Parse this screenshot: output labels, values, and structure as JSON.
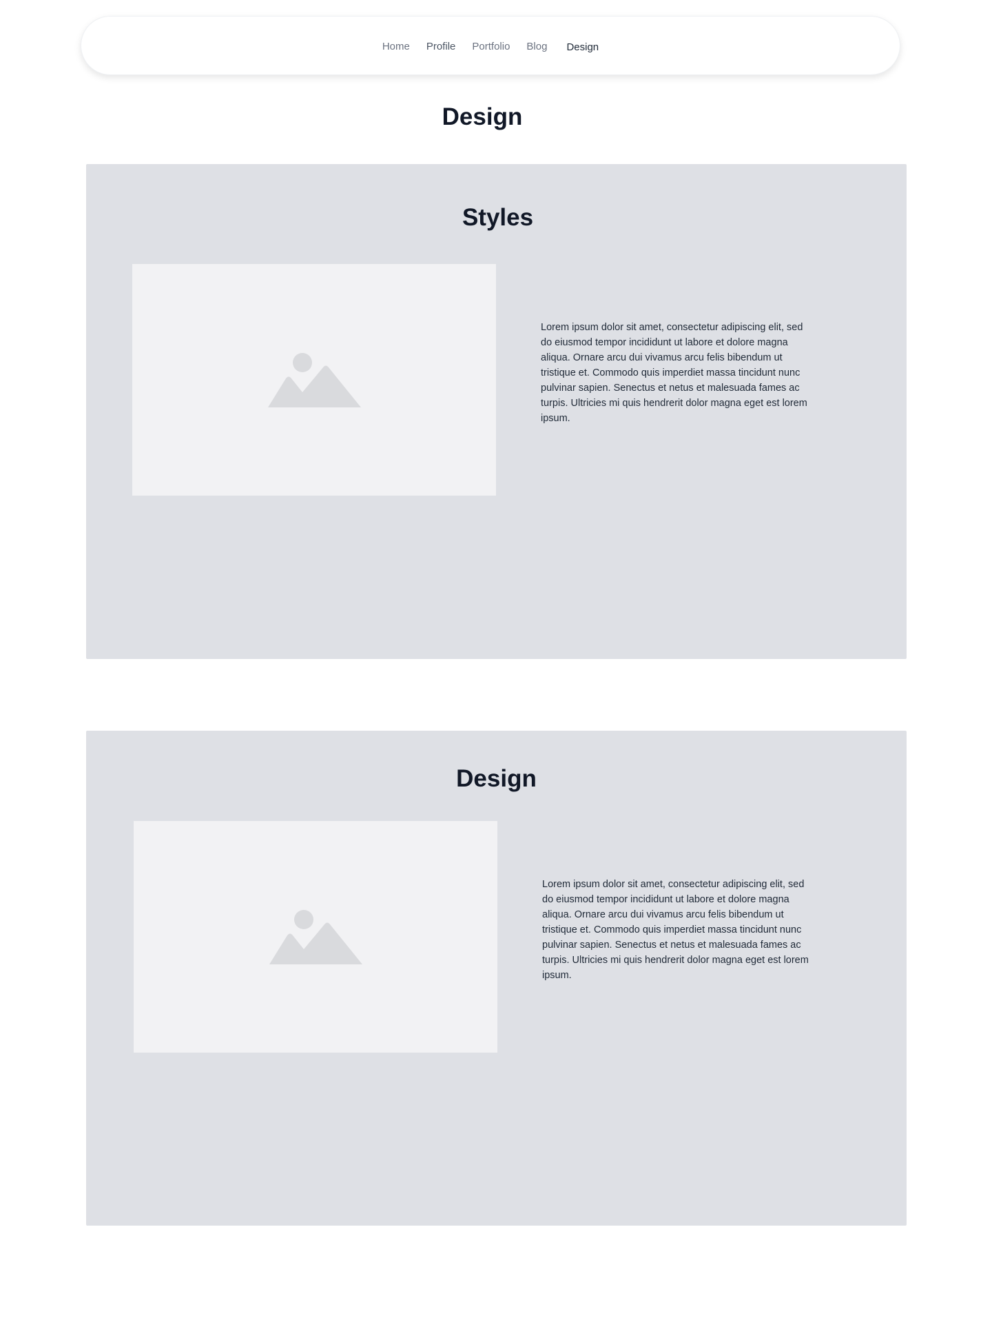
{
  "nav": {
    "links": [
      {
        "label": "Home"
      },
      {
        "label": "Profile"
      },
      {
        "label": "Portfolio"
      },
      {
        "label": "Blog"
      },
      {
        "label": "Design"
      }
    ]
  },
  "page": {
    "title": "Design"
  },
  "sections": [
    {
      "title": "Styles",
      "image_icon": "image-placeholder-icon",
      "text": "Lorem ipsum dolor sit amet, consectetur adipiscing elit, sed do eiusmod tempor incididunt ut labore et dolore magna aliqua. Ornare arcu dui vivamus arcu felis bibendum ut tristique et. Commodo quis imperdiet massa tincidunt nunc pulvinar sapien. Senectus et netus et malesuada fames ac turpis. Ultricies mi quis hendrerit dolor magna eget est lorem ipsum."
    },
    {
      "title": "Design",
      "image_icon": "image-placeholder-icon",
      "text": "Lorem ipsum dolor sit amet, consectetur adipiscing elit, sed do eiusmod tempor incididunt ut labore et dolore magna aliqua. Ornare arcu dui vivamus arcu felis bibendum ut tristique et. Commodo quis imperdiet massa tincidunt nunc pulvinar sapien. Senectus et netus et malesuada fames ac turpis. Ultricies mi quis hendrerit dolor magna eget est lorem ipsum."
    }
  ],
  "colors": {
    "section_bg": "#dee0e5",
    "image_bg": "#f2f2f4",
    "image_icon": "#d9dadd",
    "heading": "#111827",
    "nav_text": "#6b7280"
  }
}
